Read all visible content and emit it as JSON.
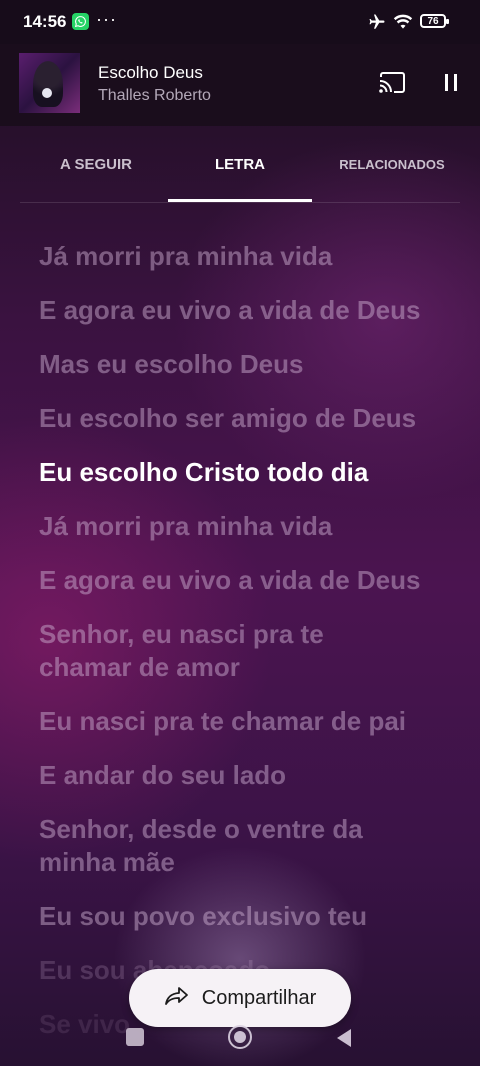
{
  "status_bar": {
    "time": "14:56",
    "notification_dots": "···",
    "battery_level": "76"
  },
  "now_playing": {
    "title": "Escolho Deus",
    "artist": "Thalles Roberto"
  },
  "tabs": [
    {
      "label": "A SEGUIR",
      "active": false
    },
    {
      "label": "LETRA",
      "active": true
    },
    {
      "label": "RELACIONADOS",
      "active": false
    }
  ],
  "lyrics": [
    "Já morri pra minha vida",
    "E agora eu vivo a vida de Deus",
    "Mas eu escolho Deus",
    "Eu escolho ser amigo de Deus",
    "Eu escolho Cristo todo dia",
    "Já morri pra minha vida",
    "E agora eu vivo a vida de Deus",
    "Senhor, eu nasci pra te chamar de amor",
    "Eu nasci pra te chamar de pai",
    "E andar do seu lado",
    "Senhor, desde o ventre da minha mãe",
    "Eu sou povo exclusivo teu",
    "Eu sou abençoado",
    "Se vivo"
  ],
  "current_lyric_index": 4,
  "share_button": {
    "label": "Compartilhar"
  },
  "colors": {
    "accent_text": "#ffffff",
    "inactive_lyric": "#cdafd2",
    "background": "#3a1240",
    "share_bg": "#f6f2f6",
    "whatsapp": "#25d366"
  },
  "icons": {
    "whatsapp": "whatsapp-icon",
    "airplane": "airplane-icon",
    "wifi": "wifi-icon",
    "battery": "battery-icon",
    "cast": "cast-icon",
    "pause": "pause-icon",
    "share": "share-icon",
    "nav_recents": "recents-icon",
    "nav_home": "home-icon",
    "nav_back": "back-icon"
  }
}
